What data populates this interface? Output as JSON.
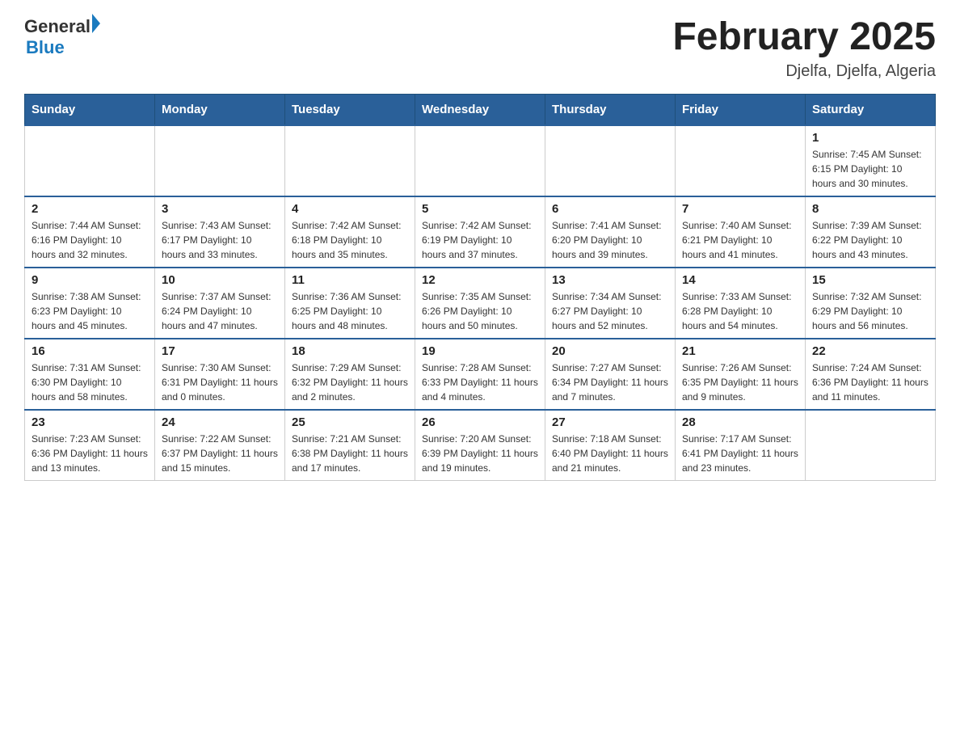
{
  "header": {
    "logo": {
      "general": "General",
      "arrow": "",
      "blue": "Blue"
    },
    "title": "February 2025",
    "location": "Djelfa, Djelfa, Algeria"
  },
  "days_of_week": [
    "Sunday",
    "Monday",
    "Tuesday",
    "Wednesday",
    "Thursday",
    "Friday",
    "Saturday"
  ],
  "weeks": [
    [
      {
        "day": "",
        "info": ""
      },
      {
        "day": "",
        "info": ""
      },
      {
        "day": "",
        "info": ""
      },
      {
        "day": "",
        "info": ""
      },
      {
        "day": "",
        "info": ""
      },
      {
        "day": "",
        "info": ""
      },
      {
        "day": "1",
        "info": "Sunrise: 7:45 AM\nSunset: 6:15 PM\nDaylight: 10 hours and 30 minutes."
      }
    ],
    [
      {
        "day": "2",
        "info": "Sunrise: 7:44 AM\nSunset: 6:16 PM\nDaylight: 10 hours and 32 minutes."
      },
      {
        "day": "3",
        "info": "Sunrise: 7:43 AM\nSunset: 6:17 PM\nDaylight: 10 hours and 33 minutes."
      },
      {
        "day": "4",
        "info": "Sunrise: 7:42 AM\nSunset: 6:18 PM\nDaylight: 10 hours and 35 minutes."
      },
      {
        "day": "5",
        "info": "Sunrise: 7:42 AM\nSunset: 6:19 PM\nDaylight: 10 hours and 37 minutes."
      },
      {
        "day": "6",
        "info": "Sunrise: 7:41 AM\nSunset: 6:20 PM\nDaylight: 10 hours and 39 minutes."
      },
      {
        "day": "7",
        "info": "Sunrise: 7:40 AM\nSunset: 6:21 PM\nDaylight: 10 hours and 41 minutes."
      },
      {
        "day": "8",
        "info": "Sunrise: 7:39 AM\nSunset: 6:22 PM\nDaylight: 10 hours and 43 minutes."
      }
    ],
    [
      {
        "day": "9",
        "info": "Sunrise: 7:38 AM\nSunset: 6:23 PM\nDaylight: 10 hours and 45 minutes."
      },
      {
        "day": "10",
        "info": "Sunrise: 7:37 AM\nSunset: 6:24 PM\nDaylight: 10 hours and 47 minutes."
      },
      {
        "day": "11",
        "info": "Sunrise: 7:36 AM\nSunset: 6:25 PM\nDaylight: 10 hours and 48 minutes."
      },
      {
        "day": "12",
        "info": "Sunrise: 7:35 AM\nSunset: 6:26 PM\nDaylight: 10 hours and 50 minutes."
      },
      {
        "day": "13",
        "info": "Sunrise: 7:34 AM\nSunset: 6:27 PM\nDaylight: 10 hours and 52 minutes."
      },
      {
        "day": "14",
        "info": "Sunrise: 7:33 AM\nSunset: 6:28 PM\nDaylight: 10 hours and 54 minutes."
      },
      {
        "day": "15",
        "info": "Sunrise: 7:32 AM\nSunset: 6:29 PM\nDaylight: 10 hours and 56 minutes."
      }
    ],
    [
      {
        "day": "16",
        "info": "Sunrise: 7:31 AM\nSunset: 6:30 PM\nDaylight: 10 hours and 58 minutes."
      },
      {
        "day": "17",
        "info": "Sunrise: 7:30 AM\nSunset: 6:31 PM\nDaylight: 11 hours and 0 minutes."
      },
      {
        "day": "18",
        "info": "Sunrise: 7:29 AM\nSunset: 6:32 PM\nDaylight: 11 hours and 2 minutes."
      },
      {
        "day": "19",
        "info": "Sunrise: 7:28 AM\nSunset: 6:33 PM\nDaylight: 11 hours and 4 minutes."
      },
      {
        "day": "20",
        "info": "Sunrise: 7:27 AM\nSunset: 6:34 PM\nDaylight: 11 hours and 7 minutes."
      },
      {
        "day": "21",
        "info": "Sunrise: 7:26 AM\nSunset: 6:35 PM\nDaylight: 11 hours and 9 minutes."
      },
      {
        "day": "22",
        "info": "Sunrise: 7:24 AM\nSunset: 6:36 PM\nDaylight: 11 hours and 11 minutes."
      }
    ],
    [
      {
        "day": "23",
        "info": "Sunrise: 7:23 AM\nSunset: 6:36 PM\nDaylight: 11 hours and 13 minutes."
      },
      {
        "day": "24",
        "info": "Sunrise: 7:22 AM\nSunset: 6:37 PM\nDaylight: 11 hours and 15 minutes."
      },
      {
        "day": "25",
        "info": "Sunrise: 7:21 AM\nSunset: 6:38 PM\nDaylight: 11 hours and 17 minutes."
      },
      {
        "day": "26",
        "info": "Sunrise: 7:20 AM\nSunset: 6:39 PM\nDaylight: 11 hours and 19 minutes."
      },
      {
        "day": "27",
        "info": "Sunrise: 7:18 AM\nSunset: 6:40 PM\nDaylight: 11 hours and 21 minutes."
      },
      {
        "day": "28",
        "info": "Sunrise: 7:17 AM\nSunset: 6:41 PM\nDaylight: 11 hours and 23 minutes."
      },
      {
        "day": "",
        "info": ""
      }
    ]
  ]
}
